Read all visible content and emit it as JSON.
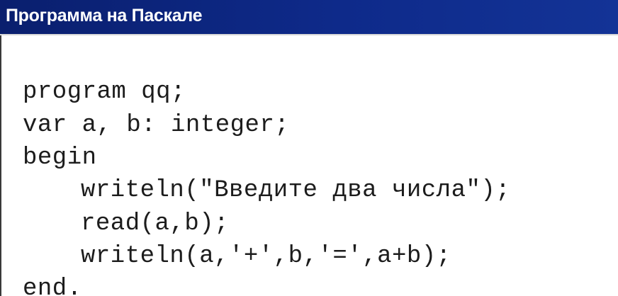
{
  "window": {
    "title": "Программа на Паскале"
  },
  "code": {
    "lines": [
      "program qq;",
      "var a, b: integer;",
      "begin",
      "writeln(\"Введите два числа\");",
      "read(a,b);",
      "writeln(a,'+',b,'=',a+b);",
      "end."
    ]
  }
}
